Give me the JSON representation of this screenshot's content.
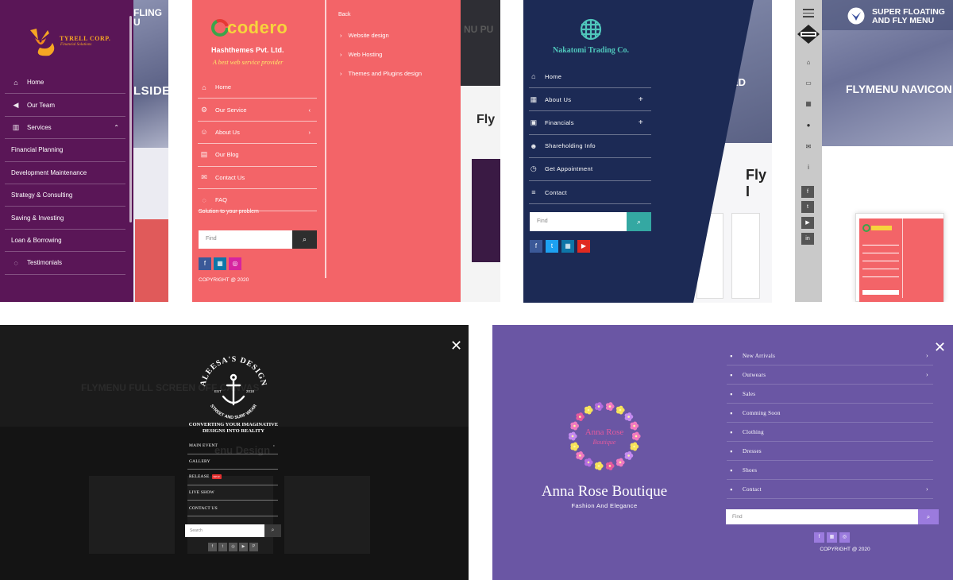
{
  "panel1": {
    "logo_name": "TYRELL CORP.",
    "logo_sub": "Financial Solutions",
    "bg_text": "LSIDE",
    "bg_top": "FLING\nU",
    "menu": [
      {
        "icon": "home-icon",
        "glyph": "⌂",
        "label": "Home"
      },
      {
        "icon": "send-icon",
        "glyph": "◀",
        "label": "Our Team"
      },
      {
        "icon": "building-icon",
        "glyph": "▥",
        "label": "Services",
        "chev": "⌃"
      },
      {
        "label": "Financial Planning"
      },
      {
        "label": "Development Maintenance"
      },
      {
        "label": "Strategy & Consulting"
      },
      {
        "label": "Saving & Investing"
      },
      {
        "label": "Loan & Borrowing"
      },
      {
        "icon": "comment-icon",
        "glyph": "◌",
        "label": "Testimonials"
      }
    ],
    "colors": {
      "sidebar": "#5a1657",
      "accent": "#f6a623"
    }
  },
  "panel2": {
    "logo_text": "codero",
    "company": "Hashthemes Pvt. Ltd.",
    "tagline": "A best web service provider",
    "menu": [
      {
        "icon": "home-icon",
        "glyph": "⌂",
        "label": "Home"
      },
      {
        "icon": "gear-icon",
        "glyph": "⚙",
        "label": "Our Service",
        "chev": "‹"
      },
      {
        "icon": "users-icon",
        "glyph": "☺",
        "label": "About Us",
        "chev": "›"
      },
      {
        "icon": "blog-icon",
        "glyph": "▤",
        "label": "Our Blog"
      },
      {
        "icon": "envelope-icon",
        "glyph": "✉",
        "label": "Contact Us"
      },
      {
        "icon": "chat-icon",
        "glyph": "◌",
        "label": "FAQ"
      }
    ],
    "solution": "Solution to your problem",
    "search_placeholder": "Find",
    "copyright": "COPYRIGHT @ 2020",
    "back": "Back",
    "submenu": [
      "Website design",
      "Web Hosting",
      "Themes and Plugins design"
    ],
    "bg_text": "NU PU",
    "bg_fly": "Fly",
    "colors": {
      "bg": "#f36468",
      "logo": "#f7d43c"
    }
  },
  "panel3": {
    "company": "Nakatomi Trading Co.",
    "menu": [
      {
        "icon": "home-icon",
        "glyph": "⌂",
        "label": "Home"
      },
      {
        "icon": "grid-icon",
        "glyph": "▦",
        "label": "About Us",
        "plus": "+"
      },
      {
        "icon": "lock-icon",
        "glyph": "▣",
        "label": "Financials",
        "plus": "+"
      },
      {
        "icon": "users-icon",
        "glyph": "☻",
        "label": "Shareholding Info"
      },
      {
        "icon": "clock-icon",
        "glyph": "◷",
        "label": "Get Appointment"
      },
      {
        "icon": "list-icon",
        "glyph": "≡",
        "label": "Contact"
      }
    ],
    "search_placeholder": "Find",
    "bg_text": "ED",
    "bg_fly": "Fly I",
    "colors": {
      "navy": "#1c2a55",
      "teal": "#34a8a2"
    }
  },
  "panel4": {
    "title_line1": "SUPER FLOATING",
    "title_line2": "AND FLY MENU",
    "hero_text": "FLYMENU NAVICON",
    "rail_icons": [
      {
        "name": "home-icon",
        "glyph": "⌂"
      },
      {
        "name": "briefcase-icon",
        "glyph": "▭"
      },
      {
        "name": "grid-icon",
        "glyph": "▦"
      },
      {
        "name": "location-icon",
        "glyph": "●"
      },
      {
        "name": "envelope-icon",
        "glyph": "✉"
      },
      {
        "name": "info-icon",
        "glyph": "i"
      }
    ],
    "social": [
      {
        "name": "facebook-icon",
        "glyph": "f"
      },
      {
        "name": "twitter-icon",
        "glyph": "t"
      },
      {
        "name": "youtube-icon",
        "glyph": "▶"
      },
      {
        "name": "linkedin-icon",
        "glyph": "in"
      }
    ]
  },
  "panel5": {
    "logo_top": "ALEESA'S DESIGN",
    "logo_bottom": "STREET AND SURF WEAR",
    "logo_est": "EST",
    "logo_year": "2018",
    "slogan_line1": "CONVERTING YOUR IMAGINATIVE",
    "slogan_line2": "DESIGNS INTO REALITY",
    "menu": [
      {
        "label": "MAIN EVENT",
        "chev": "›"
      },
      {
        "label": "GALLERY"
      },
      {
        "label": "RELEASE",
        "badge": "NEW"
      },
      {
        "label": "LIVE SHOW"
      },
      {
        "label": "CONTACT US"
      }
    ],
    "search_placeholder": "Search",
    "bg_text": "FLYMENU FULL SCREEN OFF CANVAS",
    "bg_text2": "enu Design",
    "social": [
      "f",
      "t",
      "◎",
      "▶",
      "P"
    ]
  },
  "panel6": {
    "logo_text1": "Anna Rose",
    "logo_text2": "Boutique",
    "brand": "Anna Rose Boutique",
    "brand_sub": "Fashion And Elegance",
    "menu": [
      {
        "label": "New Arrivals",
        "chev": "›"
      },
      {
        "label": "Outwears",
        "chev": "›"
      },
      {
        "label": "Sales"
      },
      {
        "label": "Comming Soon"
      },
      {
        "label": "Clothing"
      },
      {
        "label": "Dresses"
      },
      {
        "label": "Shoes"
      },
      {
        "label": "Contact",
        "chev": "›"
      }
    ],
    "search_placeholder": "Find",
    "copyright": "COPYRIGHT @ 2020",
    "colors": {
      "bg": "#6a56a4",
      "accent": "#9b7bde"
    }
  },
  "close_glyph": "✕",
  "search_glyph": "⌕"
}
